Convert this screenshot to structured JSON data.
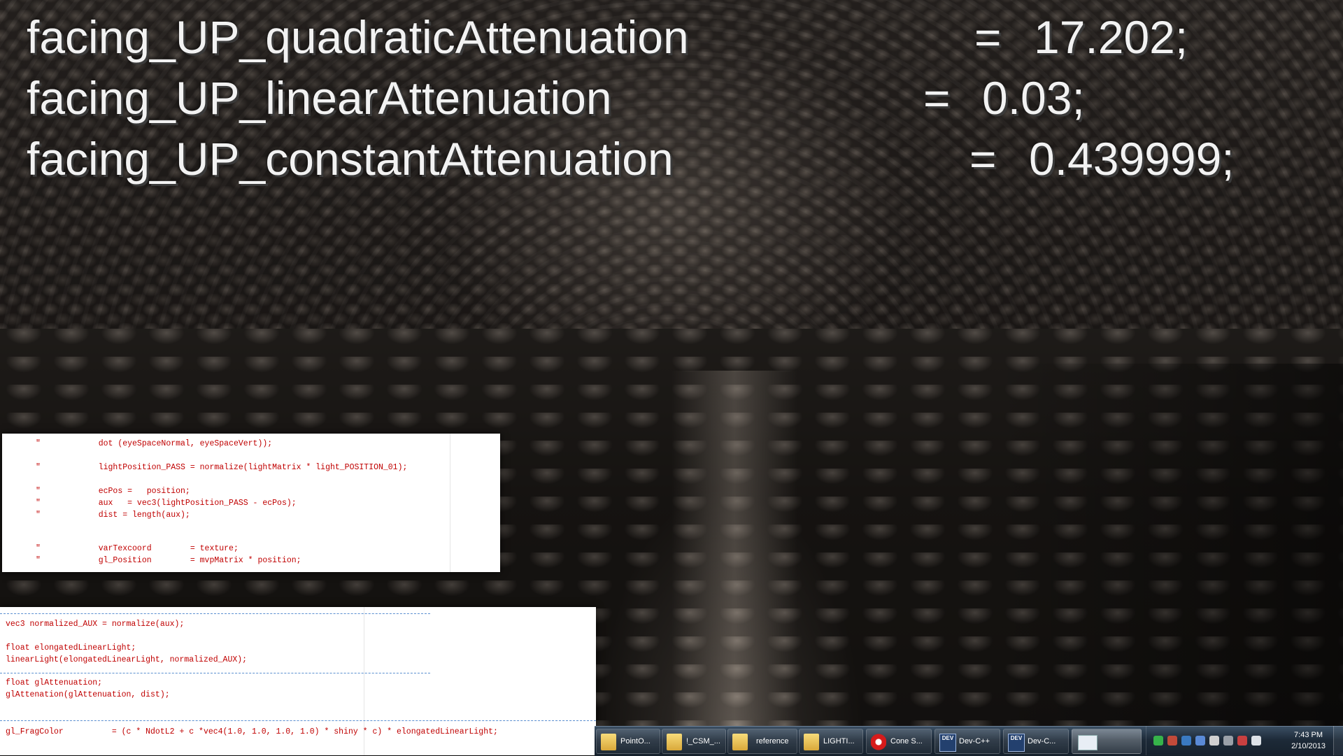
{
  "overlay": {
    "lines": [
      {
        "name": "facing_UP_quadraticAttenuation",
        "eq": "=",
        "value": "17.202;"
      },
      {
        "name": "facing_UP_linearAttenuation",
        "eq": "=",
        "value": "0.03;"
      },
      {
        "name": "facing_UP_constantAttenuation",
        "eq": "=",
        "value": "0.439999;"
      }
    ]
  },
  "vertex_code": {
    "lines": [
      "\"            dot (eyeSpaceNormal, eyeSpaceVert));",
      "\"            lightPosition_PASS = normalize(lightMatrix * light_POSITION_01);",
      "\"            ecPos =   position;",
      "\"            aux   = vec3(lightPosition_PASS - ecPos);",
      "\"            dist = length(aux);",
      "\"            varTexcoord        = texture;",
      "\"            gl_Position        = mvpMatrix * position;"
    ]
  },
  "fragment_code": {
    "lines": [
      "vec3 normalized_AUX = normalize(aux);",
      "float elongatedLinearLight;",
      "linearLight(elongatedLinearLight, normalized_AUX);",
      "float glAttenuation;",
      "glAttenation(glAttenuation, dist);",
      "gl_FragColor          = (c * NdotL2 + c *vec4(1.0, 1.0, 1.0, 1.0) * shiny * c) * elongatedLinearLight;"
    ]
  },
  "taskbar": {
    "buttons": [
      {
        "label": "PointO...",
        "icon": "folder-icon"
      },
      {
        "label": "!_CSM_...",
        "icon": "folder-icon"
      },
      {
        "label": "reference",
        "icon": "folder-icon"
      },
      {
        "label": "LIGHTI...",
        "icon": "folder-icon"
      },
      {
        "label": "Cone S...",
        "icon": "opera-icon"
      },
      {
        "label": "Dev-C++",
        "icon": "devcpp-icon"
      },
      {
        "label": "Dev-C...",
        "icon": "devcpp-icon"
      },
      {
        "label": "",
        "icon": "window-icon"
      }
    ],
    "dev_icon_text": "DEV",
    "clock": {
      "time": "7:43 PM",
      "date": "2/10/2013"
    }
  },
  "colors": {
    "code_text": "#c00000",
    "overlay_text": "#f2f2f2",
    "separator": "#5a8fd0"
  }
}
